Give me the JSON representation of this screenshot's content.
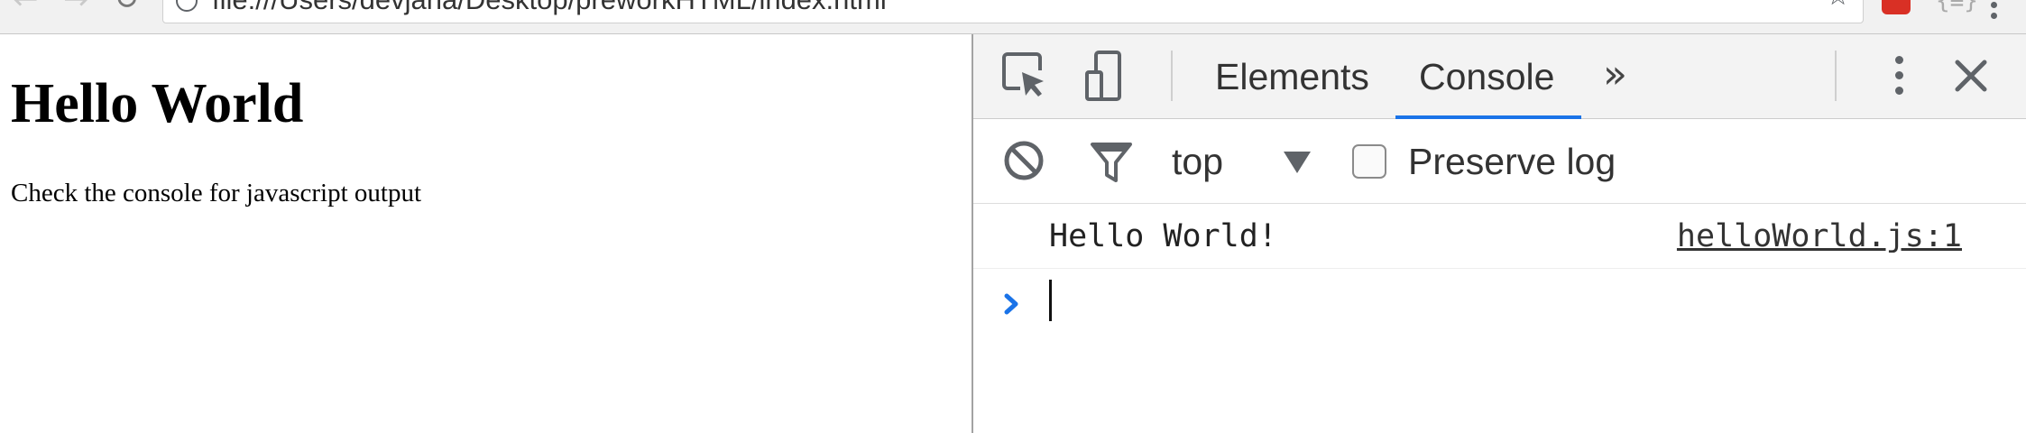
{
  "browser": {
    "url": "file:///Users/devjana/Desktop/preworkHTML/index.html",
    "extension_badge": "{≡}"
  },
  "page": {
    "heading": "Hello World",
    "subtext": "Check the console for javascript output"
  },
  "devtools": {
    "tabs": [
      {
        "label": "Elements",
        "active": false
      },
      {
        "label": "Console",
        "active": true
      }
    ],
    "more_tabs_glyph": "»",
    "console_toolbar": {
      "context": "top",
      "preserve_log_label": "Preserve log",
      "preserve_log_checked": false
    },
    "log_entries": [
      {
        "message": "Hello World!",
        "source": "helloWorld.js:1"
      }
    ]
  },
  "colors": {
    "accent": "#1a73e8",
    "devtools_toolbar_bg": "#f3f3f3"
  },
  "icons": [
    "back-icon",
    "forward-icon",
    "reload-icon",
    "info-icon",
    "star-icon",
    "inspect-element-icon",
    "device-toolbar-icon",
    "more-tabs-icon",
    "kebab-menu-icon",
    "close-icon",
    "clear-console-icon",
    "filter-icon",
    "dropdown-arrow-icon",
    "prompt-chevron-icon"
  ]
}
